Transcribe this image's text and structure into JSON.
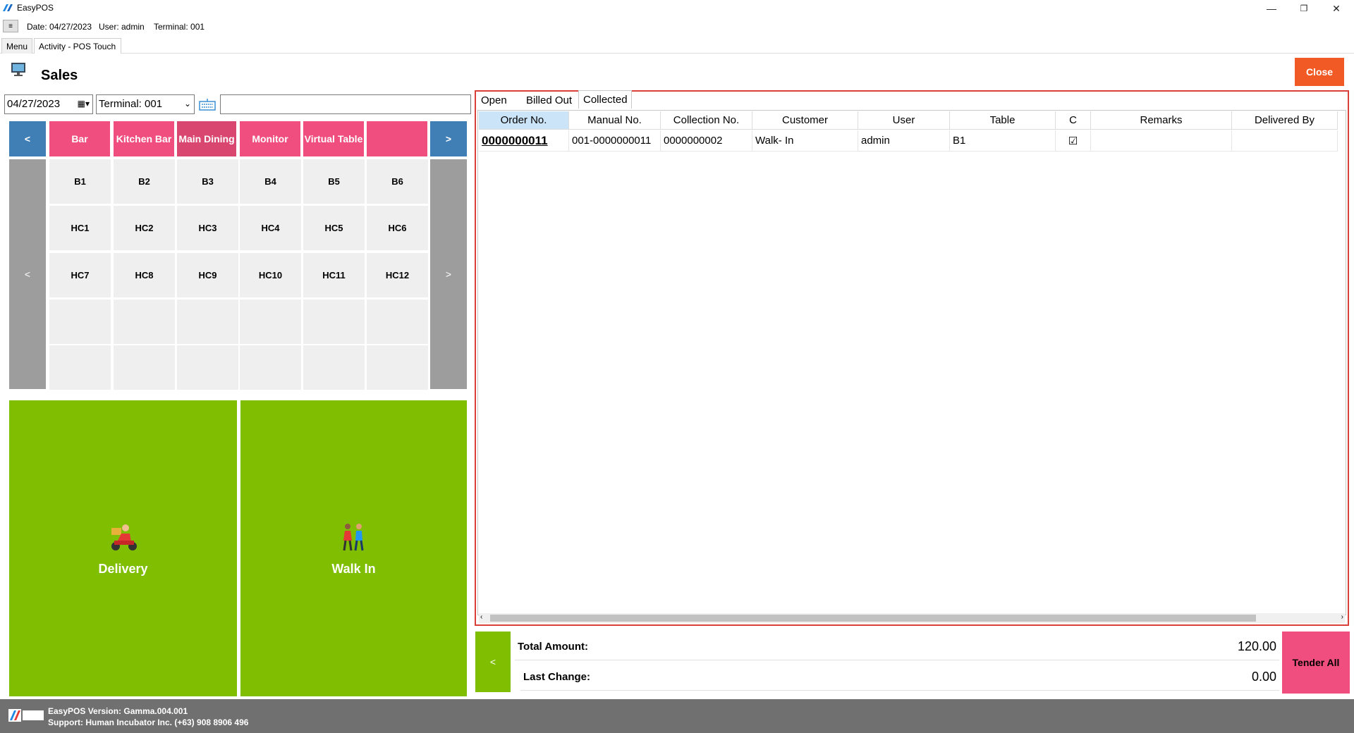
{
  "window": {
    "title": "EasyPOS"
  },
  "info": {
    "date": "Date: 04/27/2023",
    "user": "User: admin",
    "terminal": "Terminal: 001"
  },
  "tabs": [
    {
      "label": "Menu"
    },
    {
      "label": "Activity - POS Touch"
    }
  ],
  "header": {
    "title": "Sales",
    "close_label": "Close"
  },
  "filters": {
    "date": "04/27/2023",
    "terminal": "Terminal: 001",
    "search": ""
  },
  "categories": [
    {
      "label": "<"
    },
    {
      "label": "Bar"
    },
    {
      "label": "Kitchen Bar"
    },
    {
      "label": "Main Dining"
    },
    {
      "label": "Monitor"
    },
    {
      "label": "Virtual Table"
    },
    {
      "label": ""
    },
    {
      "label": ">"
    }
  ],
  "tables": [
    "B1",
    "B2",
    "B3",
    "B4",
    "B5",
    "B6",
    "HC1",
    "HC2",
    "HC3",
    "HC4",
    "HC5",
    "HC6",
    "HC7",
    "HC8",
    "HC9",
    "HC10",
    "HC11",
    "HC12",
    "",
    "",
    "",
    "",
    "",
    "",
    "",
    "",
    "",
    "",
    "",
    ""
  ],
  "side_nav": {
    "prev": "<",
    "next": ">"
  },
  "big_buttons": {
    "delivery": "Delivery",
    "walkin": "Walk In"
  },
  "subtabs": [
    {
      "label": "Open"
    },
    {
      "label": "Billed Out"
    },
    {
      "label": "Collected"
    }
  ],
  "grid": {
    "columns": [
      "Order No.",
      "Manual No.",
      "Collection No.",
      "Customer",
      "User",
      "Table",
      "C",
      "Remarks",
      "Delivered By"
    ],
    "rows": [
      {
        "order_no": "0000000011",
        "manual_no": "001-0000000011",
        "collection_no": "0000000002",
        "customer": "Walk- In",
        "user": "admin",
        "table": "B1",
        "collected": "☑",
        "remarks": "",
        "delivered_by": ""
      }
    ]
  },
  "totals": {
    "back": "<",
    "total_label": "Total Amount:",
    "total_value": "120.00",
    "change_label": "Last Change:",
    "change_value": "0.00",
    "tender_label": "Tender All"
  },
  "footer": {
    "version": "EasyPOS Version: Gamma.004.001",
    "support": "Support: Human Incubator Inc. (+63) 908 8906 496"
  },
  "colors": {
    "pink": "#f04e7f",
    "green": "#7fbe00",
    "blue": "#3f7fb6",
    "orange": "#f15a24",
    "highlight": "#d9403a"
  }
}
